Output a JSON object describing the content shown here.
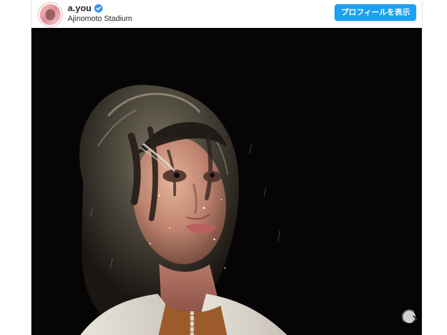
{
  "post": {
    "username": "a.you",
    "location": "Ajinomoto Stadium",
    "profile_button_label": "プロフィールを表示",
    "verified": true
  },
  "icons": {
    "verified": "verified-badge-icon",
    "next": "chevron-right-icon"
  },
  "colors": {
    "button": "#1da1f2",
    "photo_background": "#050505",
    "verified_badge": "#3897f0"
  }
}
